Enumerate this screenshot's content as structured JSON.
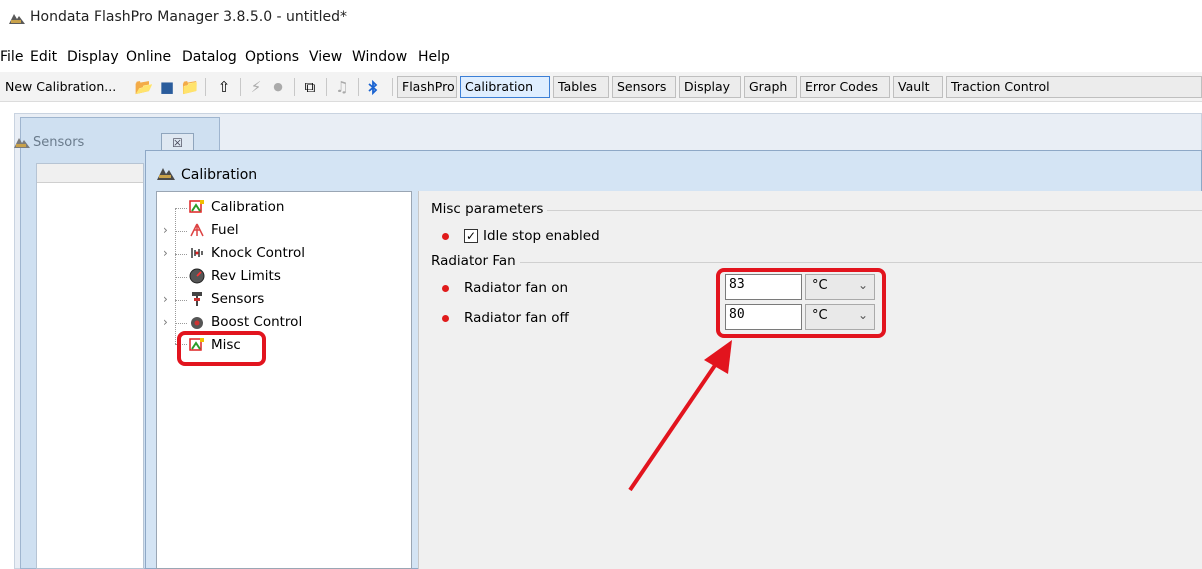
{
  "window": {
    "title": "Hondata FlashPro Manager 3.8.5.0 - untitled*"
  },
  "menu": [
    "File",
    "Edit",
    "Display",
    "Online",
    "Datalog",
    "Options",
    "View",
    "Window",
    "Help"
  ],
  "toolbar": {
    "new_calibration": "New Calibration...",
    "tabs": [
      {
        "label": "FlashPro"
      },
      {
        "label": "Calibration"
      },
      {
        "label": "Tables"
      },
      {
        "label": "Sensors"
      },
      {
        "label": "Display"
      },
      {
        "label": "Graph"
      },
      {
        "label": "Error Codes"
      },
      {
        "label": "Vault"
      },
      {
        "label": "Traction Control"
      }
    ]
  },
  "sensors_window": {
    "title": "Sensors",
    "close": "☒"
  },
  "calibration_window": {
    "title": "Calibration",
    "tree": [
      {
        "label": "Calibration",
        "icon": "calibration-icon"
      },
      {
        "label": "Fuel",
        "icon": "fuel-icon"
      },
      {
        "label": "Knock Control",
        "icon": "knock-icon"
      },
      {
        "label": "Rev Limits",
        "icon": "rev-limits-icon"
      },
      {
        "label": "Sensors",
        "icon": "sensor-icon"
      },
      {
        "label": "Boost Control",
        "icon": "boost-icon"
      },
      {
        "label": "Misc",
        "icon": "calibration-icon"
      }
    ],
    "misc": {
      "group_title": "Misc parameters",
      "idle_stop_label": "Idle stop enabled",
      "idle_stop_checked": true
    },
    "radiator": {
      "group_title": "Radiator Fan",
      "fan_on_label": "Radiator fan on",
      "fan_on_value": "83",
      "fan_on_unit": "°C",
      "fan_off_label": "Radiator fan off",
      "fan_off_value": "80",
      "fan_off_unit": "°C"
    }
  },
  "colors": {
    "highlight": "#e2141e",
    "arrow": "#e2141e",
    "bullet": "#e01b1b"
  }
}
